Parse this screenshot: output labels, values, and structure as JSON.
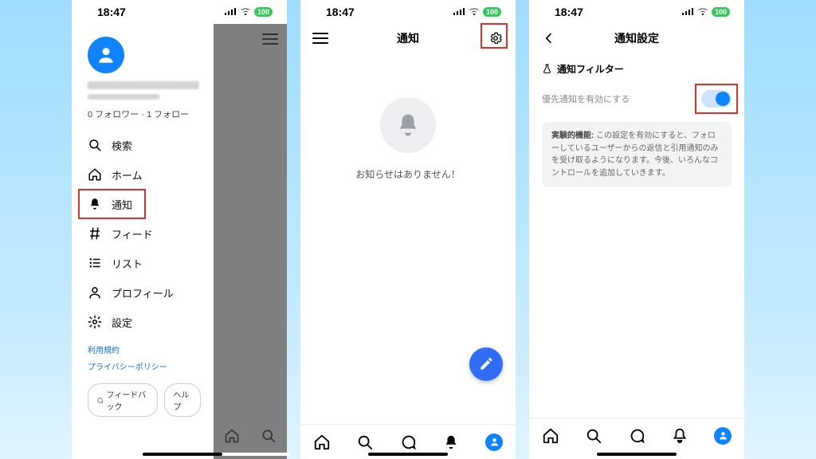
{
  "status": {
    "time": "18:47",
    "battery": "100"
  },
  "screen1": {
    "follow_line": "0 フォロワー · 1 フォロー",
    "nav": {
      "search": "検索",
      "home": "ホーム",
      "notifications": "通知",
      "feed": "フィード",
      "lists": "リスト",
      "profile": "プロフィール",
      "settings": "設定"
    },
    "legal": {
      "terms": "利用規約",
      "privacy": "プライバシーポリシー"
    },
    "feedback": "フィードバック",
    "help": "ヘルプ"
  },
  "screen2": {
    "title": "通知",
    "empty": "お知らせはありません！"
  },
  "screen3": {
    "title": "通知設定",
    "section": "通知フィルター",
    "toggle_label": "優先通知を有効にする",
    "info_prefix": "実験的機能:",
    "info_body": " この設定を有効にすると、フォローしているユーザーからの返信と引用通知のみを受け取るようになります。今後、いろんなコントロールを追加していきます。"
  }
}
